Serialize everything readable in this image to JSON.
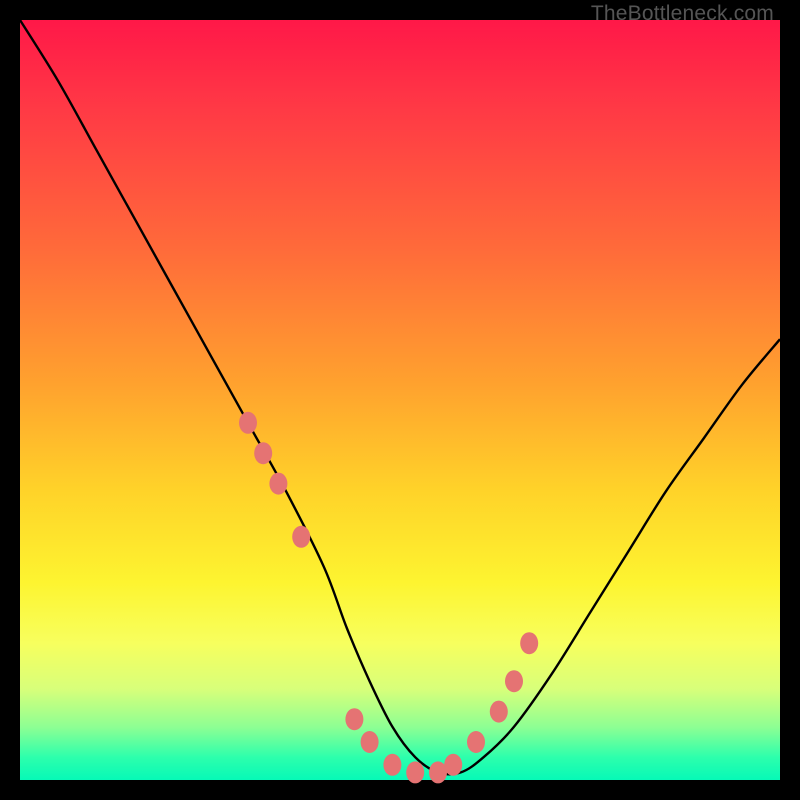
{
  "watermark": "TheBottleneck.com",
  "chart_data": {
    "type": "line",
    "title": "",
    "xlabel": "",
    "ylabel": "",
    "xlim": [
      0,
      100
    ],
    "ylim": [
      0,
      100
    ],
    "grid": false,
    "legend": false,
    "series": [
      {
        "name": "bottleneck-curve",
        "x": [
          0,
          5,
          10,
          15,
          20,
          25,
          30,
          35,
          40,
          43,
          46,
          49,
          52,
          55,
          58,
          61,
          65,
          70,
          75,
          80,
          85,
          90,
          95,
          100
        ],
        "values": [
          100,
          92,
          83,
          74,
          65,
          56,
          47,
          38,
          28,
          20,
          13,
          7,
          3,
          1,
          1,
          3,
          7,
          14,
          22,
          30,
          38,
          45,
          52,
          58
        ]
      }
    ],
    "markers": {
      "name": "highlight-points",
      "color": "#e57373",
      "x": [
        30,
        32,
        34,
        37,
        44,
        46,
        49,
        52,
        55,
        57,
        60,
        63,
        65,
        67
      ],
      "values": [
        47,
        43,
        39,
        32,
        8,
        5,
        2,
        1,
        1,
        2,
        5,
        9,
        13,
        18
      ]
    },
    "background_gradient": {
      "top": "#ff1848",
      "mid": "#ffd329",
      "bottom": "#06f9b7"
    }
  }
}
